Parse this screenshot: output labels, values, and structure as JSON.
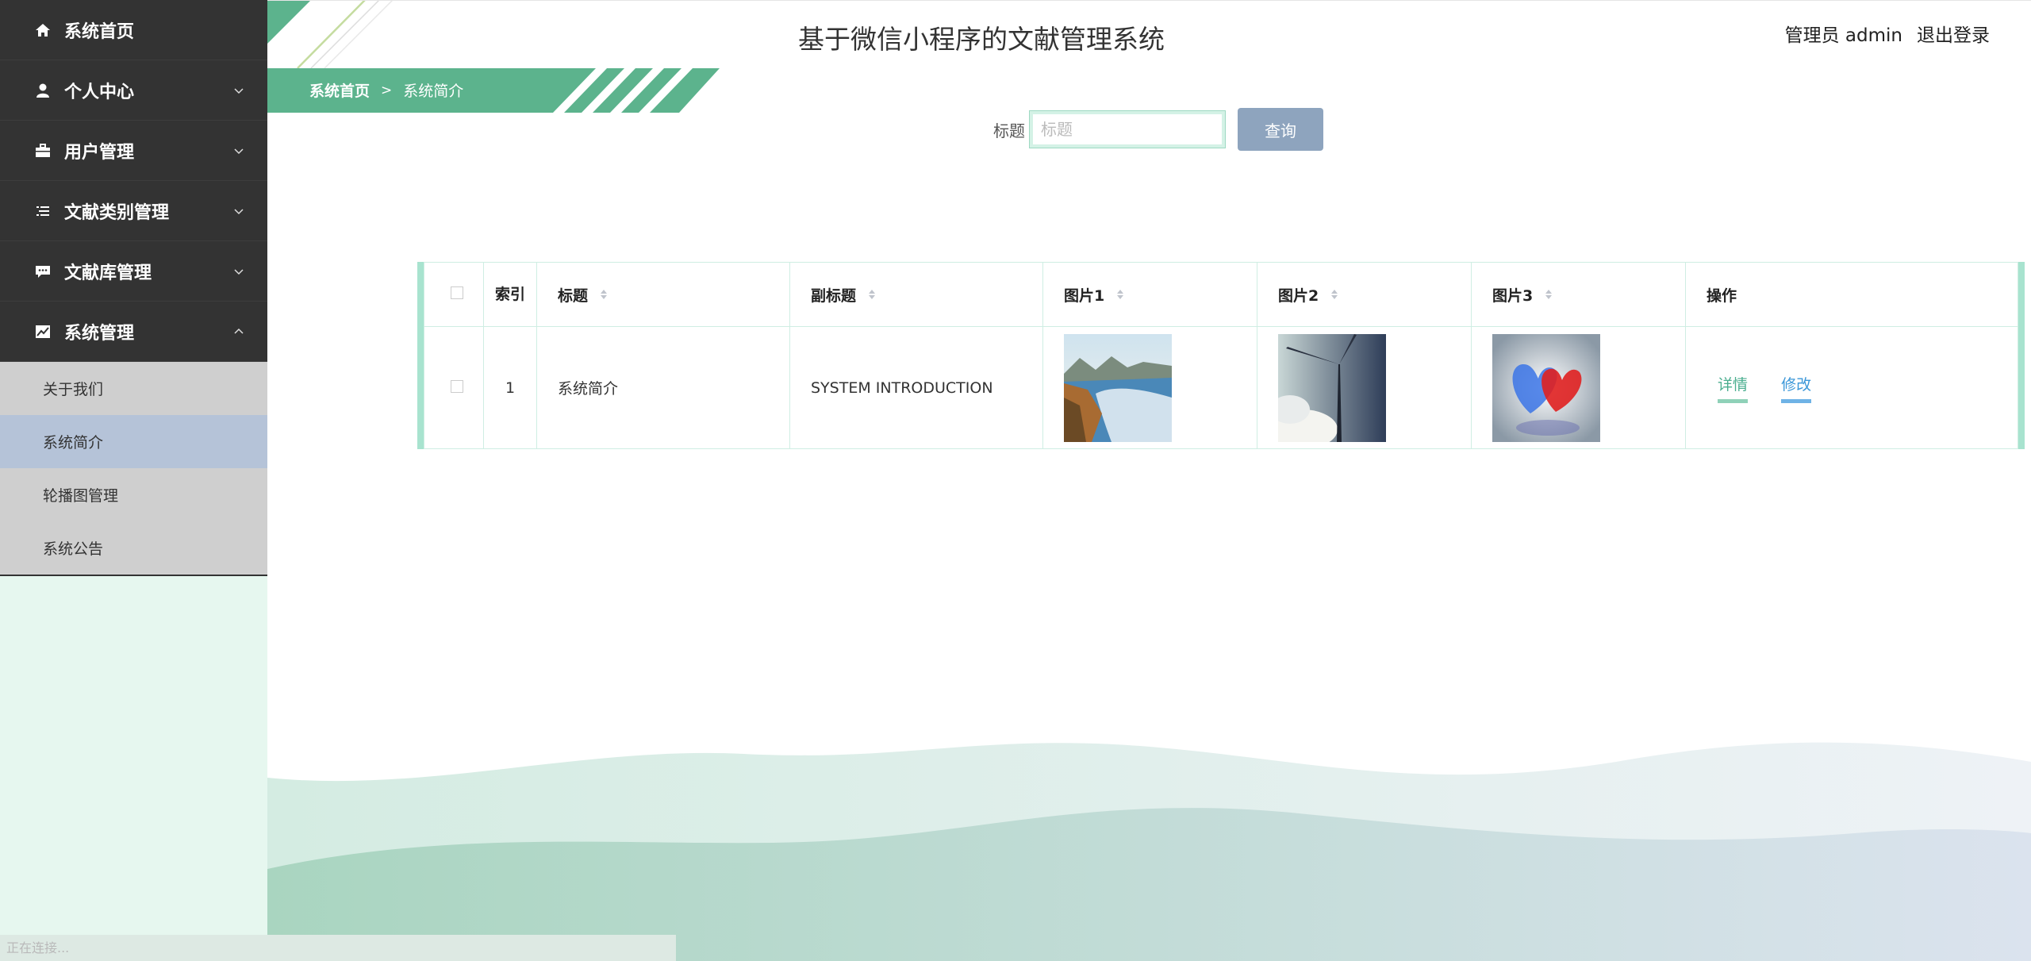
{
  "app": {
    "title": "基于微信小程序的文献管理系统",
    "user_label": "管理员 admin",
    "logout_label": "退出登录"
  },
  "sidebar": {
    "items": [
      {
        "label": "系统首页",
        "icon": "home-icon"
      },
      {
        "label": "个人中心",
        "icon": "user-icon"
      },
      {
        "label": "用户管理",
        "icon": "briefcase-icon"
      },
      {
        "label": "文献类别管理",
        "icon": "list-icon"
      },
      {
        "label": "文献库管理",
        "icon": "chat-icon"
      },
      {
        "label": "系统管理",
        "icon": "chart-icon"
      }
    ],
    "submenu": [
      {
        "label": "关于我们"
      },
      {
        "label": "系统简介"
      },
      {
        "label": "轮播图管理"
      },
      {
        "label": "系统公告"
      }
    ]
  },
  "breadcrumb": {
    "home": "系统首页",
    "separator": ">",
    "current": "系统简介"
  },
  "search": {
    "label": "标题",
    "placeholder": "标题",
    "value": "",
    "button": "查询"
  },
  "table": {
    "headers": {
      "index": "索引",
      "title": "标题",
      "subtitle": "副标题",
      "pic1": "图片1",
      "pic2": "图片2",
      "pic3": "图片3",
      "actions": "操作"
    },
    "rows": [
      {
        "index": "1",
        "title": "系统简介",
        "subtitle": "SYSTEM INTRODUCTION",
        "pic1": "coast-photo",
        "pic2": "wind-turbine-photo",
        "pic3": "hearts-photo",
        "action_detail": "详情",
        "action_edit": "修改"
      }
    ]
  },
  "status": {
    "text": "正在连接..."
  },
  "colors": {
    "sidebar_bg": "#333333",
    "submenu_bg": "#cfcfcf",
    "submenu_active": "#b5c3d8",
    "accent_green": "#5cb38d",
    "button": "#8ea4be"
  }
}
